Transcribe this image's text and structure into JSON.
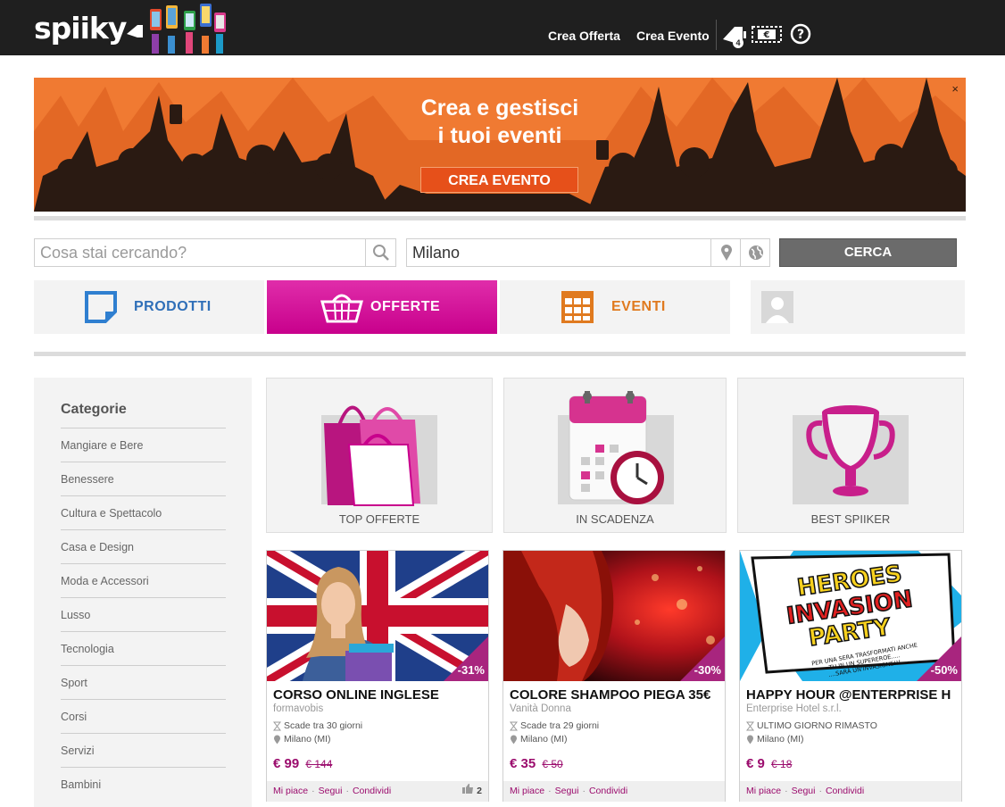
{
  "header": {
    "logo_text": "spiiky",
    "nav": [
      {
        "label": "Crea Offerta"
      },
      {
        "label": "Crea Evento"
      }
    ],
    "notification_count": "4",
    "icons": [
      "megaphone-bell-icon",
      "ticket-euro-icon",
      "help-icon"
    ]
  },
  "banner": {
    "line1": "Crea e gestisci",
    "line2": "i tuoi eventi",
    "button": "CREA EVENTO",
    "close": "×"
  },
  "search": {
    "query_placeholder": "Cosa stai cercando?",
    "location_value": "Milano",
    "button": "CERCA"
  },
  "tabs": [
    {
      "label": "PRODOTTI",
      "color": "#2f6fb8"
    },
    {
      "label": "OFFERTE",
      "color": "#ffffff",
      "active": true
    },
    {
      "label": "EVENTI",
      "color": "#e07a1f"
    }
  ],
  "sidebar": {
    "title": "Categorie",
    "categories": [
      "Mangiare e Bere",
      "Benessere",
      "Cultura e Spettacolo",
      "Casa e Design",
      "Moda e Accessori",
      "Lusso",
      "Tecnologia",
      "Sport",
      "Corsi",
      "Servizi",
      "Bambini"
    ]
  },
  "features": [
    {
      "label": "TOP OFFERTE",
      "icon": "shopping-bags-icon"
    },
    {
      "label": "IN SCADENZA",
      "icon": "calendar-clock-icon"
    },
    {
      "label": "BEST SPIIKER",
      "icon": "trophy-icon"
    }
  ],
  "offers": [
    {
      "title": "CORSO ONLINE INGLESE",
      "merchant": "formavobis",
      "expiry": "Scade tra 30 giorni",
      "location": "Milano (MI)",
      "price": "€ 99",
      "old_price": "€ 144",
      "discount": "-31%",
      "likes": "2"
    },
    {
      "title": "COLORE SHAMPOO PIEGA 35€",
      "merchant": "Vanità Donna",
      "expiry": "Scade tra 29 giorni",
      "location": "Milano (MI)",
      "price": "€ 35",
      "old_price": "€ 50",
      "discount": "-30%",
      "likes": ""
    },
    {
      "title": "HAPPY HOUR @ENTERPRISE H",
      "merchant": "Enterprise Hotel s.r.l.",
      "expiry": "ULTIMO GIORNO RIMASTO",
      "location": "Milano (MI)",
      "price": "€ 9",
      "old_price": "€ 18",
      "discount": "-50%",
      "likes": "",
      "poster_lines": [
        "HEROES",
        "INVASION",
        "PARTY"
      ],
      "poster_small": [
        "PER UNA SERA TRASFORMATI ANCHE",
        "TU IN UN SUPEREROE.....",
        "....SARÀ UN'INVASIONE!!!"
      ]
    }
  ],
  "card_actions": {
    "like": "Mi piace",
    "follow": "Segui",
    "share": "Condividi",
    "sep": "·"
  },
  "colors": {
    "accent_magenta": "#c8008c",
    "price_purple": "#9b0c6d",
    "banner_orange": "#f07a32",
    "header_bg": "#1f1f1f"
  }
}
